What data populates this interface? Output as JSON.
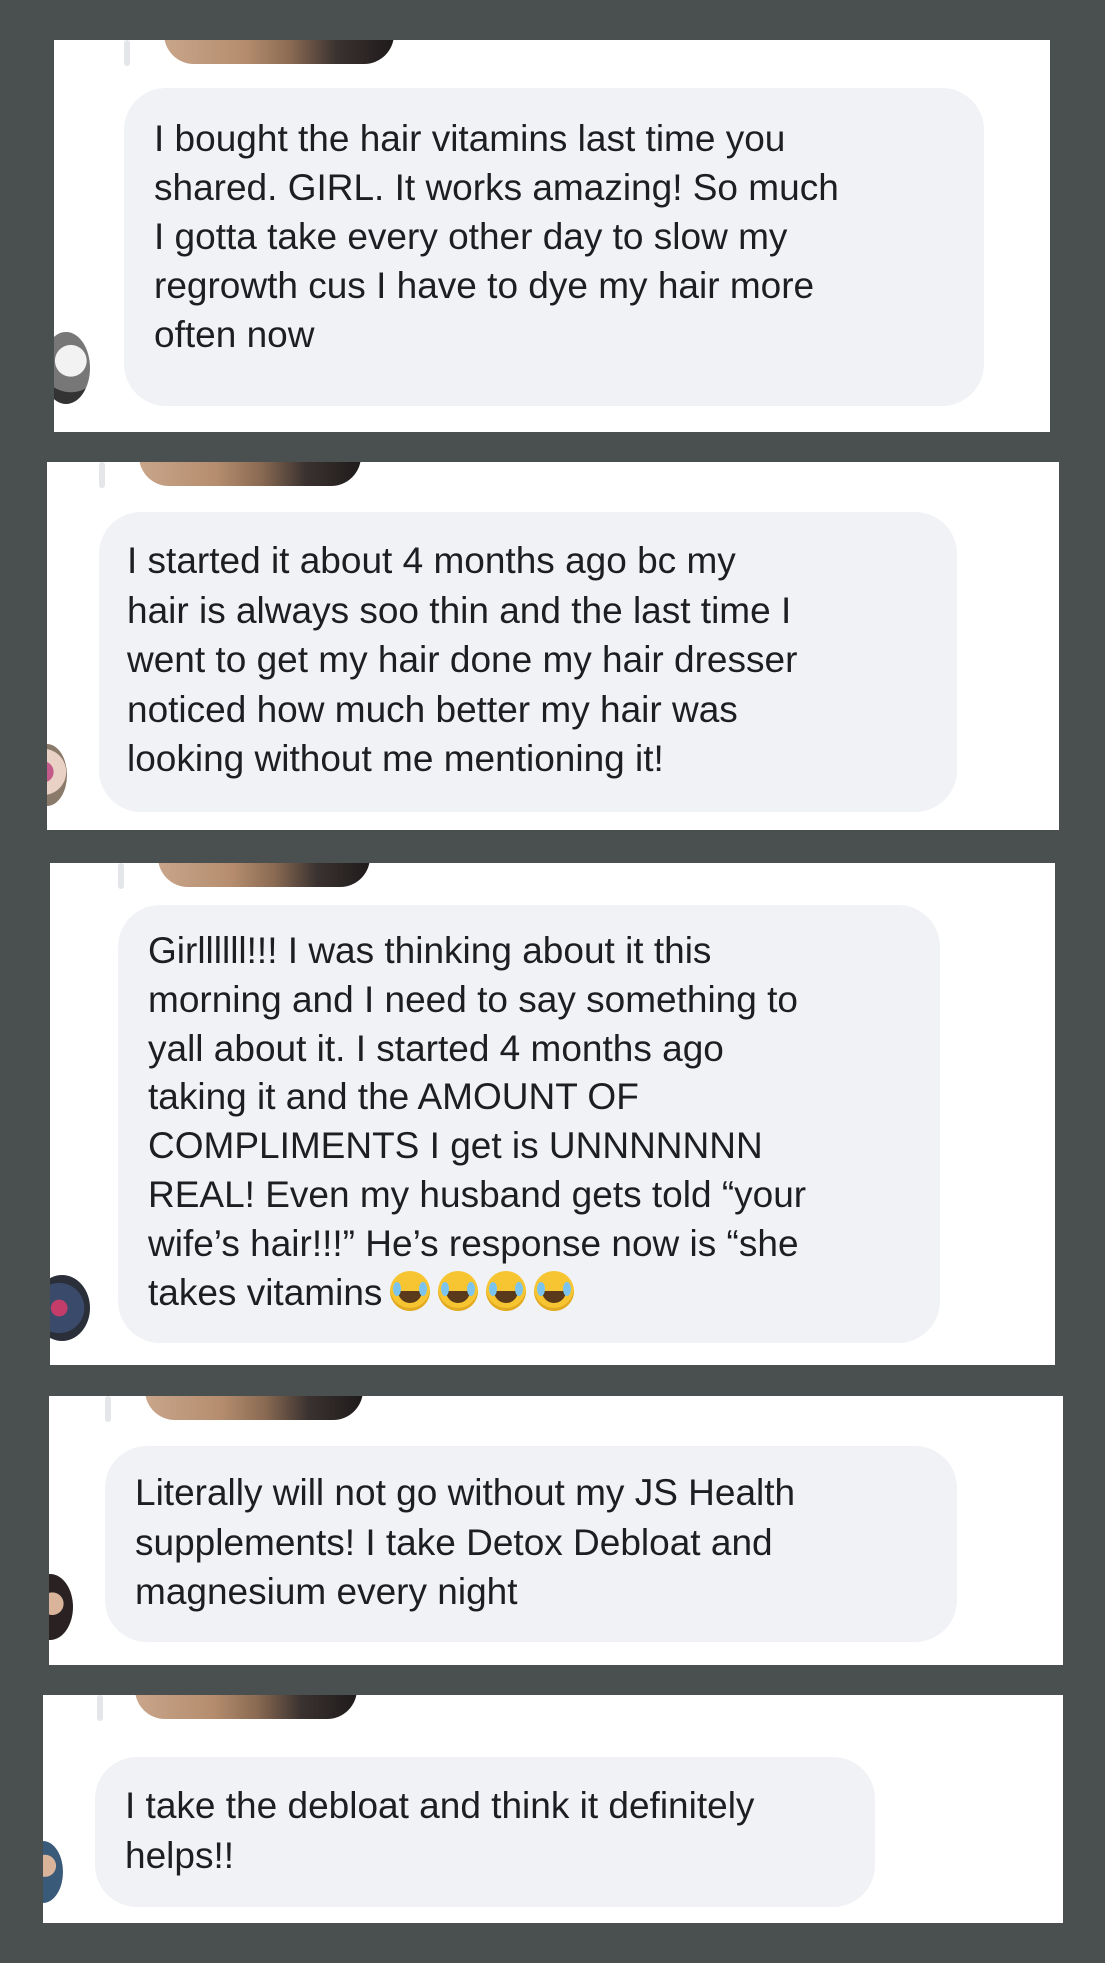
{
  "comments": [
    {
      "text": "I bought the hair vitamins last time you\nshared. GIRL. It works amazing! So much\nI gotta take every other day to slow my\nregrowth cus I have to dye my hair more\noften now",
      "avatar_icon": "dog-avatar-icon"
    },
    {
      "text": "I started it about 4 months ago bc my\nhair is always soo thin and the last time I\nwent to get my hair done my hair dresser\nnoticed how much better my hair was\nlooking without me mentioning it!",
      "avatar_icon": "user-avatar-icon"
    },
    {
      "text": "Girllllll!!! I was thinking about it this\nmorning and I need to say something to\nyall about it. I started 4 months ago\ntaking it and the AMOUNT OF\nCOMPLIMENTS I get is UNNNNNNN\nREAL! Even my husband gets told “your\nwife’s hair!!!” He’s response now is “she\ntakes vitamins",
      "emoji_icon": "tears-of-joy-emoji-icon",
      "emoji_count": 4,
      "avatar_icon": "user-avatar-icon"
    },
    {
      "text": "Literally will not go without my JS Health\nsupplements! I take Detox Debloat and\nmagnesium every night",
      "avatar_icon": "user-avatar-icon"
    },
    {
      "text": "I take the debloat and think it definitely\nhelps!!",
      "avatar_icon": "user-avatar-icon"
    }
  ],
  "colors": {
    "background": "#4a4f4f",
    "panel": "#ffffff",
    "bubble": "#f0f2f5",
    "text": "#1c1e21"
  }
}
